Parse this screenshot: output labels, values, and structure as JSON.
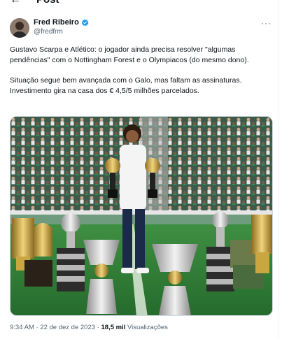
{
  "topbar": {
    "back_icon": "arrow-left-icon",
    "title": "Post"
  },
  "author": {
    "display_name": "Fred Ribeiro",
    "handle": "@fredfrm",
    "verified_icon": "verified-badge-icon",
    "verified_color": "#1d9bf0"
  },
  "more_label": "···",
  "tweet": {
    "paragraph1": "Gustavo Scarpa e Atlético: o jogador ainda precisa resolver \"algumas pendências\" com o Nottingham Forest e o Olympiacos (do mesmo dono).",
    "paragraph2": "Situação segue bem avançada com o Galo, mas faltam as assinaturas. Investimento gira na casa dos € 4,5/5 milhões parcelados."
  },
  "footer": {
    "time": "9:34 AM",
    "separator": " · ",
    "date": "22 de dez de 2023",
    "views_count": "18,5 mil",
    "views_label": "Visualizações"
  }
}
